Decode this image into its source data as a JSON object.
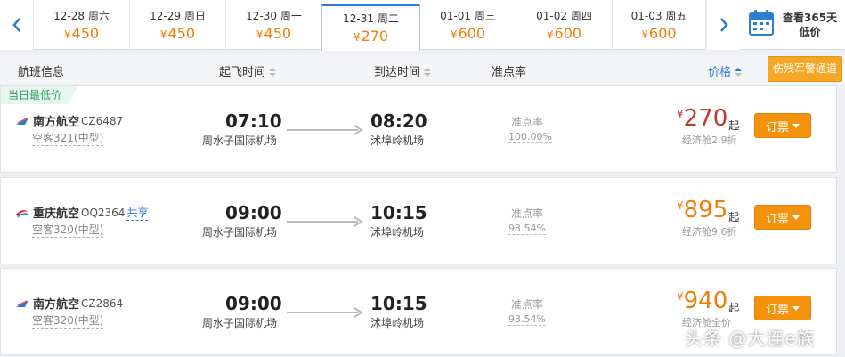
{
  "date_strip": {
    "dates": [
      {
        "date": "12-28 周六",
        "price": "450"
      },
      {
        "date": "12-29 周日",
        "price": "450"
      },
      {
        "date": "12-30 周一",
        "price": "450"
      },
      {
        "date": "12-31 周二",
        "price": "270",
        "selected": true
      },
      {
        "date": "01-01 周三",
        "price": "600"
      },
      {
        "date": "01-02 周四",
        "price": "600"
      },
      {
        "date": "01-03 周五",
        "price": "600"
      }
    ],
    "currency": "¥",
    "calendar_line1": "查看365天",
    "calendar_line2": "低价"
  },
  "header": {
    "flight_info": "航班信息",
    "departure_time": "起飞时间",
    "arrival_time": "到达时间",
    "ontime_rate": "准点率",
    "price": "价格",
    "military_channel": "伤残军警通道"
  },
  "flights": [
    {
      "badge": "当日最低价",
      "airline": "南方航空",
      "flight_no": "CZ6487",
      "share": "",
      "aircraft": "空客321(中型)",
      "dep_time": "07:10",
      "dep_airport": "周水子国际机场",
      "arr_time": "08:20",
      "arr_airport": "沭埠岭机场",
      "ontime_label": "准点率",
      "ontime_value": "100.00%",
      "currency": "¥",
      "price": "270",
      "price_suffix": "起",
      "cabin": "经济舱2.9折",
      "book": "订票",
      "price_color": "#c0392b",
      "airline_logo": "china-southern-logo"
    },
    {
      "badge": "",
      "airline": "重庆航空",
      "flight_no": "OQ2364",
      "share": "共享",
      "aircraft": "空客320(中型)",
      "dep_time": "09:00",
      "dep_airport": "周水子国际机场",
      "arr_time": "10:15",
      "arr_airport": "沭埠岭机场",
      "ontime_label": "准点率",
      "ontime_value": "93.54%",
      "currency": "¥",
      "price": "895",
      "price_suffix": "起",
      "cabin": "经济舱9.6折",
      "book": "订票",
      "price_color": "#f07d0a",
      "airline_logo": "chongqing-airlines-logo"
    },
    {
      "badge": "",
      "airline": "南方航空",
      "flight_no": "CZ2864",
      "share": "",
      "aircraft": "空客320(中型)",
      "dep_time": "09:00",
      "dep_airport": "周水子国际机场",
      "arr_time": "10:15",
      "arr_airport": "沭埠岭机场",
      "ontime_label": "准点率",
      "ontime_value": "93.54%",
      "currency": "¥",
      "price": "940",
      "price_suffix": "起",
      "cabin": "经济舱全价",
      "book": "订票",
      "price_color": "#f07d0a",
      "airline_logo": "china-southern-logo"
    }
  ],
  "watermark": "头条 @大连e族",
  "colors": {
    "accent_blue": "#2c7ed1",
    "price_orange": "#f07d0a",
    "lowest_price_red": "#c0392b",
    "book_button": "#f5920c",
    "badge_green": "#2aa160"
  }
}
